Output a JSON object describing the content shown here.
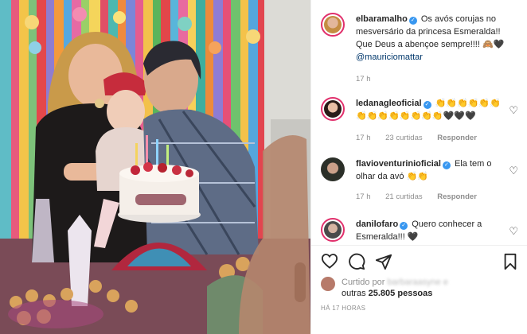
{
  "caption": {
    "username": "elbaramalho",
    "text": "Os avós corujas no mesversário da princesa Esmeralda!! Que Deus a abençoe sempre!!!! 🙈🖤",
    "mention": "@mauriciomattar",
    "time": "17 h"
  },
  "comments": [
    {
      "username": "ledanagleoficial",
      "text": "👏👏👏👏👏👏👏👏👏👏👏👏👏👏🖤🖤🖤",
      "time": "17 h",
      "likes": "23 curtidas",
      "reply": "Responder"
    },
    {
      "username": "flavioventurinioficial",
      "text": "Ela tem o olhar da avó 👏👏",
      "time": "17 h",
      "likes": "21 curtidas",
      "reply": "Responder"
    },
    {
      "username": "danilofaro",
      "text": "Quero conhecer a Esmeralda!!! 🖤",
      "time": "",
      "likes": "",
      "reply": ""
    }
  ],
  "likes": {
    "prefix": "Curtido por",
    "blurred_name": "barbaraasyne e",
    "line2_prefix": "outras",
    "count": "25.805",
    "line2_suffix": "pessoas"
  },
  "timestamp": "HÁ 17 HORAS",
  "icons": {
    "verified": "verified-badge-icon",
    "heart": "heart-icon",
    "comment": "comment-icon",
    "share": "share-icon",
    "save": "bookmark-icon"
  },
  "colors": {
    "verified": "#3897f0",
    "mention": "#00376b",
    "muted": "#8e8e8e",
    "story_ring": "#e1306c"
  }
}
